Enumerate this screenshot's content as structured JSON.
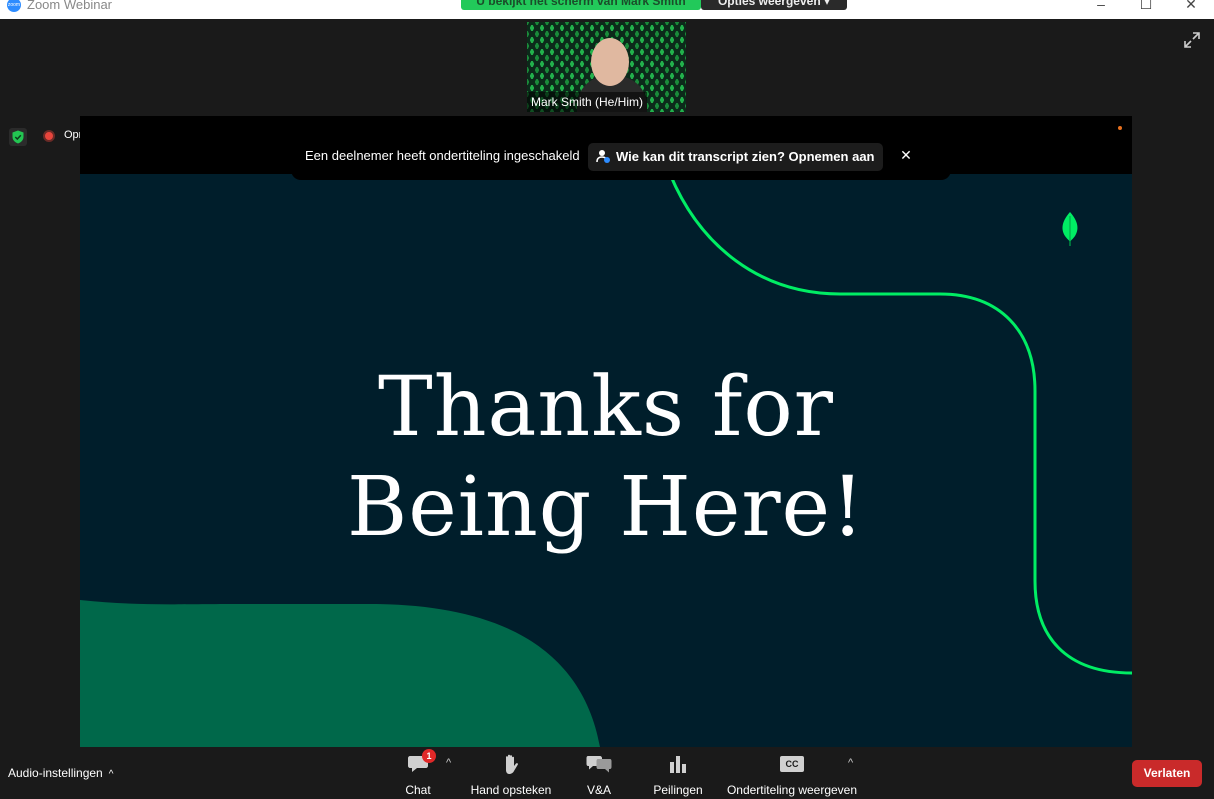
{
  "window": {
    "title": "Zoom Webinar",
    "app_icon_text": "zoom"
  },
  "share_bar": {
    "viewing_text": "U bekijkt het scherm van Mark Smith",
    "options_label": "Opties weergeven"
  },
  "speaker": {
    "name": "Mark Smith (He/Him)"
  },
  "recording": {
    "label": "Opnemen"
  },
  "notice": {
    "text": "Een deelnemer heeft ondertiteling ingeschakeld",
    "link_label": "Wie kan dit transcript zien? Opnemen aan",
    "close_glyph": "✕"
  },
  "slide": {
    "title_line1": "Thanks for",
    "title_line2": "Being Here!",
    "colors": {
      "background": "#001e2b",
      "accent": "#00ed64",
      "shape": "#00684a"
    }
  },
  "toolbar": {
    "audio_label": "Audio-instellingen",
    "chat_label": "Chat",
    "chat_badge": "1",
    "hand_label": "Hand opsteken",
    "qa_label": "V&A",
    "polls_label": "Peilingen",
    "captions_label": "Ondertiteling weergeven",
    "captions_icon_text": "CC",
    "leave_label": "Verlaten",
    "caret_glyph": "^"
  },
  "icons": [
    "zoom-app-icon",
    "minimize-icon",
    "maximize-icon",
    "close-icon",
    "fullscreen-icon",
    "shield-icon",
    "record-icon",
    "person-icon",
    "leaf-icon",
    "chat-icon",
    "hand-icon",
    "qa-icon",
    "polls-icon",
    "captions-icon"
  ]
}
